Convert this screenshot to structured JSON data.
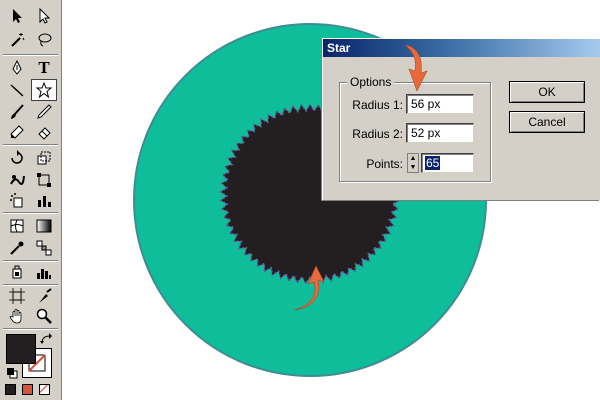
{
  "dialog": {
    "title": "Star",
    "group_label": "Options",
    "radius1_label": "Radius 1:",
    "radius1_value": "56 px",
    "radius2_label": "Radius 2:",
    "radius2_value": "52 px",
    "points_label": "Points:",
    "points_value": "65",
    "ok_label": "OK",
    "cancel_label": "Cancel"
  },
  "toolbox": {
    "type_tool_glyph": "T",
    "active_tool": "star-tool"
  },
  "colors": {
    "outer_circle": "#0ebd9a",
    "star_fill": "#231f20",
    "star_stroke": "#6e58a6",
    "arrow": "#e86a3c",
    "title_gradient_start": "#0a246a",
    "title_gradient_end": "#a6caf0",
    "fill_swatch": "#231f20",
    "mode_color": "#d4553e"
  }
}
